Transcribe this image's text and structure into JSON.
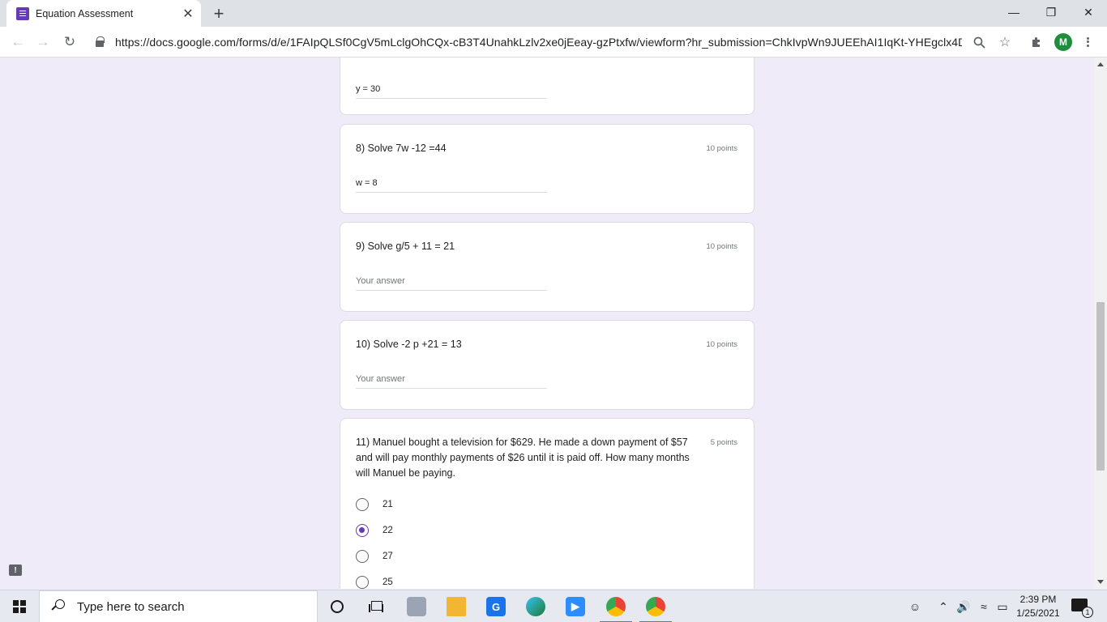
{
  "browser": {
    "tab_title": "Equation Assessment",
    "tab_close": "✕",
    "new_tab": "+",
    "url_host": "https://docs.google.com",
    "url_path": "/forms/d/e/1FAIpQLSf0CgV5mLclgOhCQx-cB3T4UnahkLzlv2xe0jEeay-gzPtxfw/viewform?hr_submission=ChkIvpWn9JUEEhAI1IqKt-YHEgclx4DM...",
    "avatar_letter": "M",
    "icons": [
      "back-icon",
      "forward-icon",
      "reload-icon",
      "lock-icon",
      "zoom-icon",
      "star-icon",
      "extensions-icon",
      "menu-icon"
    ]
  },
  "window_controls": {
    "minimize": "—",
    "maximize": "❐",
    "close": "✕"
  },
  "form": {
    "q7": {
      "answer": "y = 30"
    },
    "q8": {
      "title": "8) Solve 7w -12 =44",
      "points": "10 points",
      "answer": "w = 8"
    },
    "q9": {
      "title": "9) Solve g/5 + 11 = 21",
      "points": "10 points",
      "placeholder": "Your answer"
    },
    "q10": {
      "title": "10) Solve -2 p +21 = 13",
      "points": "10 points",
      "placeholder": "Your answer"
    },
    "q11": {
      "title_line1": "11) Manuel bought a television for $629. He made a down payment of $57",
      "title_line2": "and will pay monthly payments of $26 until it is paid off. How many months",
      "title_line3": "will Manuel be paying.",
      "points": "5 points",
      "options": [
        "21",
        "22",
        "27",
        "25"
      ],
      "selected": "22"
    }
  },
  "feedback_icon": "!",
  "taskbar": {
    "search_placeholder": "Type here to search",
    "time": "2:39 PM",
    "date": "1/25/2021",
    "notification_count": "1",
    "apps": [
      "cortana-icon",
      "task-view-icon",
      "app-icon",
      "file-explorer-icon",
      "google-icon",
      "edge-icon",
      "zoom-icon",
      "chrome-icon",
      "chrome-icon"
    ]
  },
  "colors": {
    "accent": "#673ab7",
    "page_bg": "#f0ebf8",
    "card_border": "#dadce0"
  }
}
